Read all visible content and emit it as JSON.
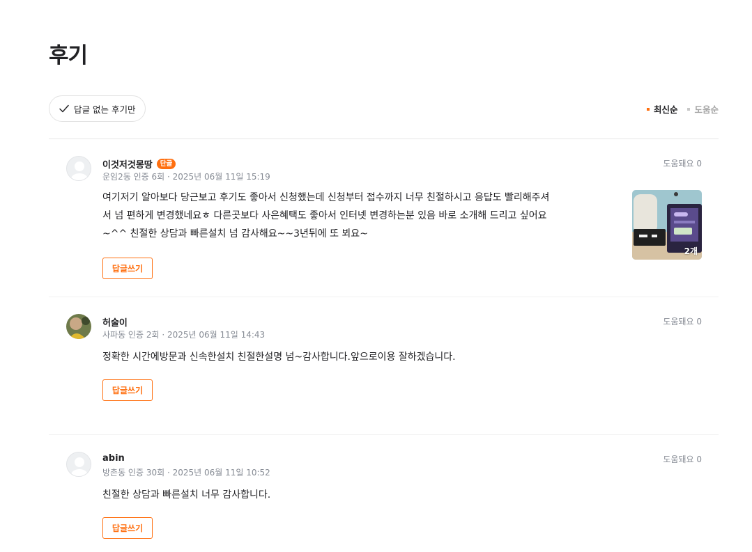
{
  "page": {
    "title": "후기"
  },
  "filter": {
    "label": "답글 없는 후기만"
  },
  "sort": {
    "options": [
      "최신순",
      "도움순"
    ],
    "selected": "최신순"
  },
  "colors": {
    "accent": "#ff6f0f",
    "text": "#212124",
    "muted": "#868b94"
  },
  "reviews": [
    {
      "author": "이것저것몽땅",
      "badge": "단골",
      "meta": "운임2동 인증 6회 · 2025년 06월 11일 15:19",
      "helpful": "도움돼요 0",
      "lines": [
        "여기저기 알아보다 당근보고 후기도 좋아서 신청했는데 신청부터 접수까지 너무 친절하시고 응답도 빨리해주셔",
        "서 넘 편하게 변경했네요ㅎ 다른곳보다 사은혜택도 좋아서 인터넷 변경하는분 있음 바로 소개해 드리고 싶어요",
        "~^^ 친절한 상담과 빠른설치 넘 감사해요~~3년뒤에 또 뵈요~"
      ],
      "photo_count": "2개",
      "reply_label": "답글쓰기",
      "avatar": "default-avatar-icon"
    },
    {
      "author": "허술이",
      "meta": "사파동 인증 2회 · 2025년 06월 11일 14:43",
      "helpful": "도움돼요 0",
      "lines": [
        "정확한 시간에방문과 신속한설치 친절한설명 넘~감사합니다.앞으로이용 잘하겠습니다."
      ],
      "reply_label": "답글쓰기",
      "avatar": "photo-avatar"
    },
    {
      "author": "abin",
      "meta": "방촌동 인증 30회 · 2025년 06월 11일 10:52",
      "helpful": "도움돼요 0",
      "lines": [
        "친절한 상담과 빠른설치 너무 감사합니다."
      ],
      "reply_label": "답글쓰기",
      "avatar": "default-avatar-icon"
    }
  ]
}
